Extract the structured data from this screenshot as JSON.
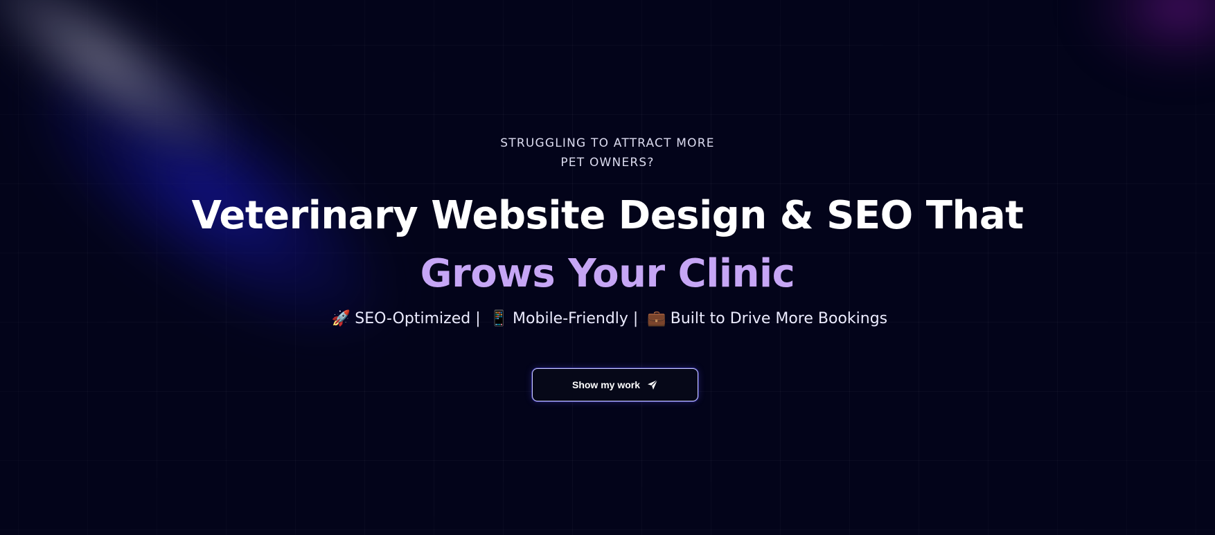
{
  "hero": {
    "eyebrow_line1": "STRUGGLING TO ATTRACT MORE",
    "eyebrow_line2": "PET OWNERS?",
    "headline_line1": "Veterinary Website Design & SEO That",
    "headline_line2": "Grows Your Clinic",
    "features": {
      "item1_emoji": "🚀",
      "item1_text": "SEO-Optimized |",
      "item2_emoji": "📱",
      "item2_text": "Mobile-Friendly |",
      "item3_emoji": "💼",
      "item3_text": "Built to Drive More Bookings"
    },
    "cta_label": "Show my work",
    "cta_icon": "paper-plane-icon"
  },
  "colors": {
    "background": "#03041a",
    "headline": "#ffffff",
    "accent": "#c6a6f5",
    "button_border": "#cfd2ff"
  }
}
